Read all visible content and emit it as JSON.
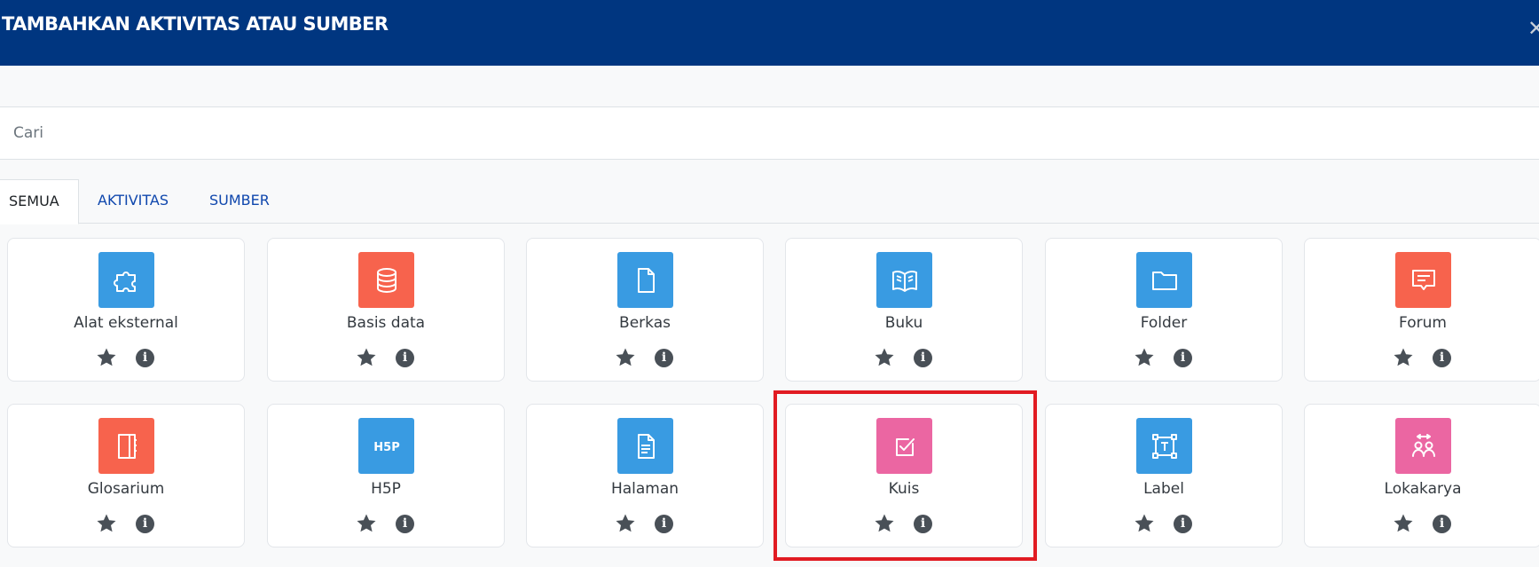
{
  "header": {
    "title": "TAMBAHKAN AKTIVITAS ATAU SUMBER"
  },
  "search": {
    "placeholder": "Cari"
  },
  "tabs": [
    {
      "label": "SEMUA"
    },
    {
      "label": "AKTIVITAS"
    },
    {
      "label": "SUMBER"
    }
  ],
  "colors": {
    "blue": "#399be2",
    "red": "#f7634d",
    "pink": "#eb66a2",
    "header": "#003680",
    "highlight": "#e11b22"
  },
  "modules": [
    {
      "name": "Alat eksternal",
      "icon": "puzzle-icon"
    },
    {
      "name": "Basis data",
      "icon": "database-icon"
    },
    {
      "name": "Berkas",
      "icon": "file-icon"
    },
    {
      "name": "Buku",
      "icon": "book-icon"
    },
    {
      "name": "Folder",
      "icon": "folder-icon"
    },
    {
      "name": "Forum",
      "icon": "forum-icon"
    },
    {
      "name": "Glosarium",
      "icon": "glossary-icon"
    },
    {
      "name": "H5P",
      "icon": "h5p-icon"
    },
    {
      "name": "Halaman",
      "icon": "page-icon"
    },
    {
      "name": "Kuis",
      "icon": "quiz-icon"
    },
    {
      "name": "Label",
      "icon": "label-icon"
    },
    {
      "name": "Lokakarya",
      "icon": "workshop-icon"
    }
  ]
}
